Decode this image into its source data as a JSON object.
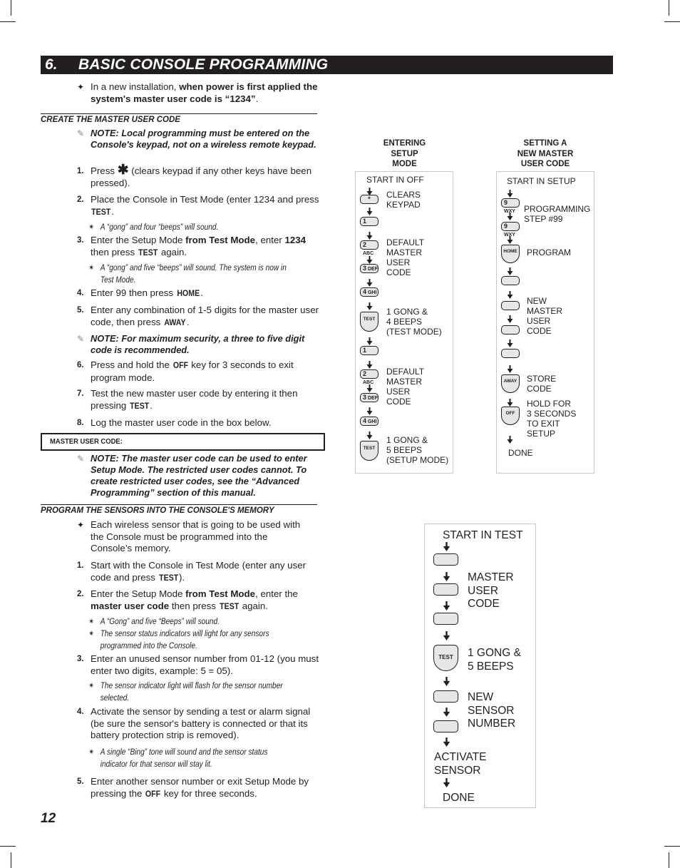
{
  "header": {
    "section_number": "6.",
    "section_title": "BASIC CONSOLE PROGRAMMING"
  },
  "intro": {
    "symbol": "✦",
    "text_plain": "In a new installation, ",
    "text_bold": "when power is first applied the system's master user code is “1234”",
    "text_end": "."
  },
  "create_master": {
    "heading": "CREATE THE MASTER USER CODE",
    "note1": "NOTE: Local programming must be entered on the Console's keypad, not on a wireless remote keypad.",
    "steps": [
      {
        "n": "1.",
        "a": "Press ",
        "key": "✱",
        "b": " (clears keypad if any other keys have been pressed)."
      },
      {
        "n": "2.",
        "a": "Place the Console in Test Mode (enter 1234 and press ",
        "key": "TEST",
        "b": "."
      },
      {
        "n": "3.",
        "a": "Enter the Setup Mode ",
        "bold1": "from Test Mode",
        "mid": ", enter ",
        "bold2": "1234",
        "c": " then press ",
        "key": "TEST",
        "b": " again."
      },
      {
        "n": "4.",
        "a": "Enter 99 then press ",
        "key": "HOME",
        "b": "."
      },
      {
        "n": "5.",
        "a": "Enter any combination of 1-5 digits for the master user code, then press ",
        "key": "AWAY",
        "b": "."
      },
      {
        "n": "6.",
        "a": "Press and hold the ",
        "key": "OFF",
        "b": " key for 3 seconds to exit program mode."
      },
      {
        "n": "7.",
        "a": "Test the new master user code by entering it then pressing ",
        "key": "TEST",
        "b": "."
      },
      {
        "n": "8.",
        "a": "Log the master user code in the box below."
      }
    ],
    "sub2": "A “gong” and four “beeps” will sound.",
    "sub3": "A “gong” and five “beeps” will sound. The system is now in Test Mode.",
    "note2": "NOTE: For maximum security, a three to five digit code is recommended.",
    "master_code_label": "MASTER USER CODE:",
    "note3": "NOTE: The master user code can be used to enter Setup Mode. The restricted user codes cannot. To create restricted user codes, see the “Advanced Programming” section of this manual."
  },
  "sensors": {
    "heading": "PROGRAM THE SENSORS INTO THE CONSOLE'S MEMORY",
    "intro": "Each wireless sensor that is going to be used with the Console must be programmed into the Console’s memory.",
    "step1": {
      "n": "1.",
      "a": "Start with the Console in Test Mode (enter any user code and press ",
      "key": "TEST",
      "b": ")."
    },
    "step2": {
      "n": "2.",
      "a": "Enter the Setup Mode ",
      "bold1": "from Test Mode",
      "mid": ", enter the ",
      "bold2": "master user code",
      "c": " then press ",
      "key": "TEST",
      "b": " again."
    },
    "sub2a": "A “Gong” and five “Beeps” will sound.",
    "sub2b": "The sensor status indicators will light for any sensors programmed into the Console.",
    "step3": {
      "n": "3.",
      "a": "Enter an unused sensor number from 01-12 (you must enter two digits, example: 5 = 05)."
    },
    "sub3": "The sensor indicator light will flash for the sensor number selected.",
    "step4": {
      "n": "4.",
      "a": "Activate the sensor by sending a test or alarm signal (be sure the sensor's battery is connected or that its battery protection strip is removed)."
    },
    "sub4": "A single “Bing” tone will sound and the sensor status indicator for that sensor will stay lit.",
    "step5": {
      "n": "5.",
      "a": "Enter another sensor number or exit Setup Mode by pressing the ",
      "key": "OFF",
      "b": " key for three seconds."
    }
  },
  "symbols": {
    "note": "✎",
    "sub": "✴",
    "bullet": "✦"
  },
  "flow_setup": {
    "heading": [
      "ENTERING",
      "SETUP",
      "MODE"
    ],
    "start": "START IN OFF",
    "keys": {
      "star": "*",
      "k1": "1",
      "k2": "2",
      "k2s": "ABC",
      "k3": "3",
      "k3s": "DEF",
      "k4": "4",
      "k4s": "GHI",
      "test": "TEST"
    },
    "labels": {
      "clears": [
        "CLEARS",
        "KEYPAD"
      ],
      "default1": [
        "DEFAULT",
        "MASTER",
        "USER",
        "CODE"
      ],
      "gong4": [
        "1 GONG &",
        "4 BEEPS",
        "(TEST MODE)"
      ],
      "default2": [
        "DEFAULT",
        "MASTER",
        "USER",
        "CODE"
      ],
      "gong5": [
        "1 GONG &",
        "5 BEEPS",
        "(SETUP MODE)"
      ]
    }
  },
  "flow_master": {
    "heading": [
      "SETTING A",
      "NEW MASTER",
      "USER CODE"
    ],
    "start": "START IN SETUP",
    "keys": {
      "k9": "9",
      "k9s": "WXY",
      "home": "HOME",
      "away": "AWAY",
      "off": "OFF"
    },
    "labels": {
      "prog": [
        "PROGRAMMING",
        "STEP #99"
      ],
      "program": "PROGRAM",
      "newcode": [
        "NEW",
        "MASTER",
        "USER",
        "CODE"
      ],
      "store": [
        "STORE",
        "CODE"
      ],
      "hold": [
        "HOLD FOR",
        "3 SECONDS",
        "TO EXIT",
        "SETUP"
      ],
      "done": "DONE"
    }
  },
  "flow_sensor": {
    "start": "START IN TEST",
    "test_key": "TEST",
    "labels": {
      "master": [
        "MASTER",
        "USER",
        "CODE"
      ],
      "gong": [
        "1 GONG &",
        "5 BEEPS"
      ],
      "newsensor": [
        "NEW",
        "SENSOR",
        "NUMBER"
      ],
      "activate": [
        "ACTIVATE",
        "SENSOR"
      ],
      "done": "DONE"
    }
  },
  "page_number": "12"
}
